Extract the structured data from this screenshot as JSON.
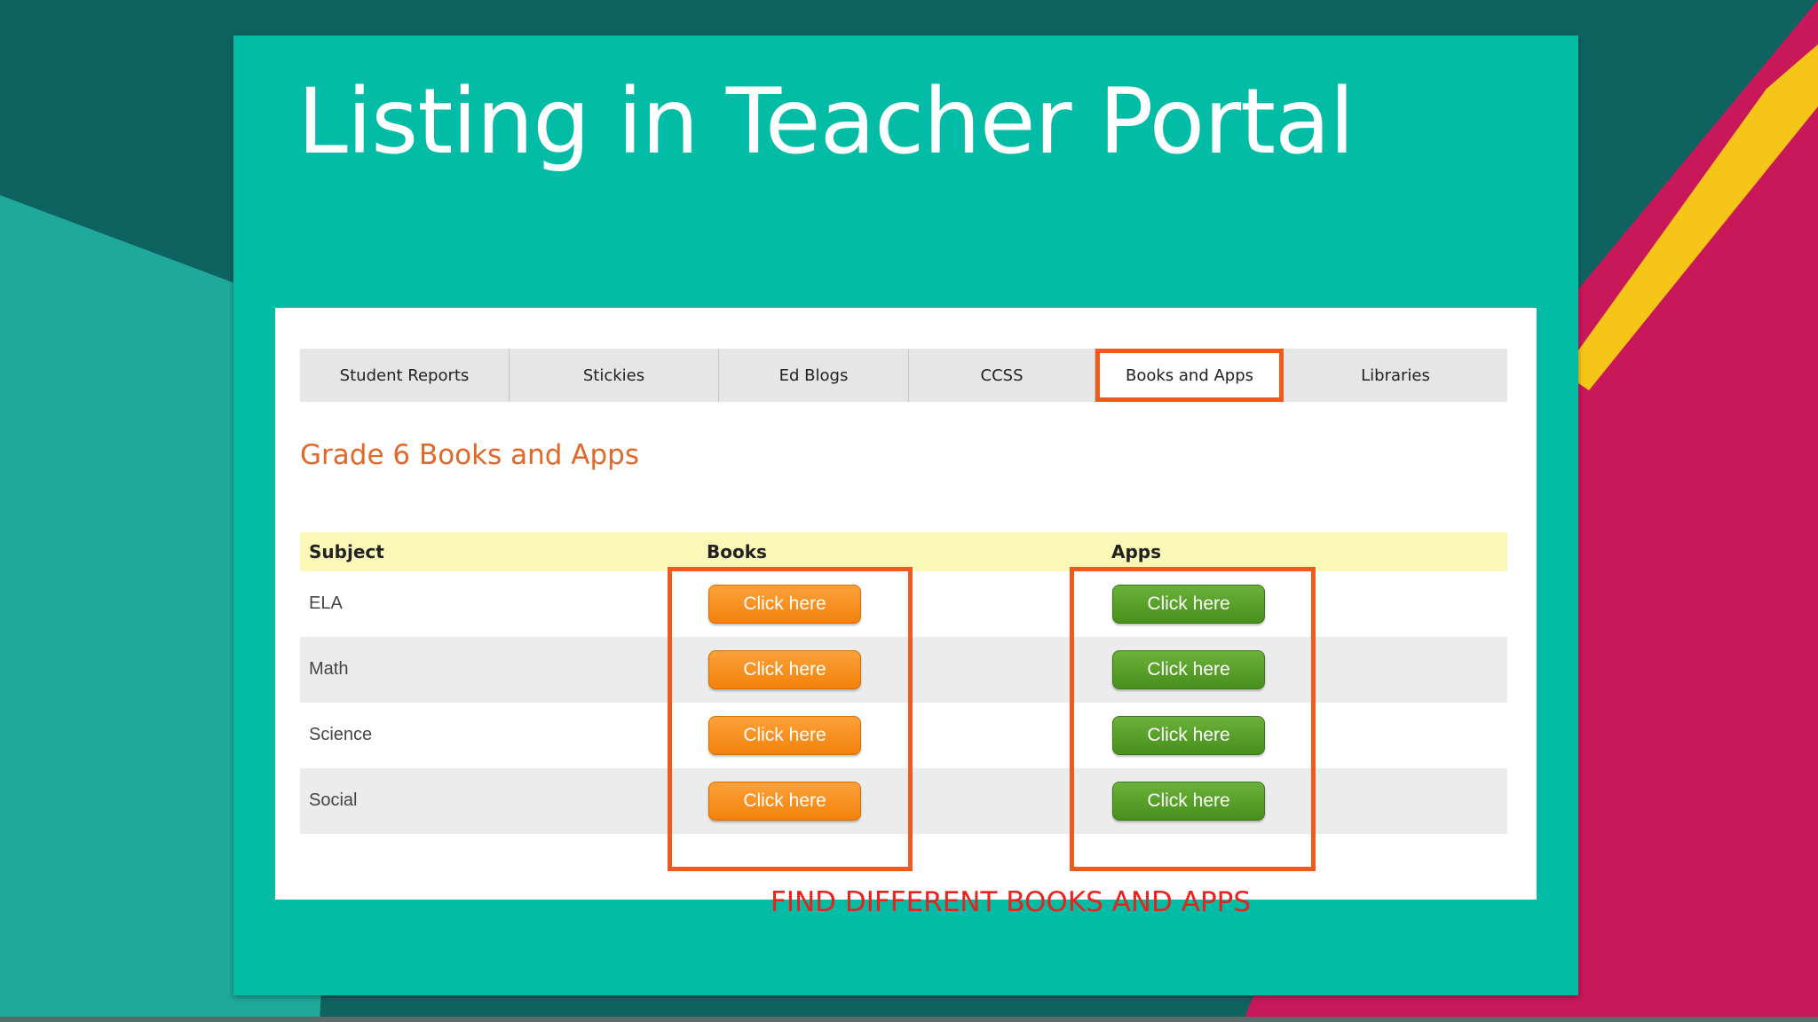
{
  "slide": {
    "title": "Listing in Teacher Portal",
    "background_color": "#03bca6"
  },
  "portal": {
    "tabs": [
      {
        "label": "Student Reports",
        "active": false
      },
      {
        "label": "Stickies",
        "active": false
      },
      {
        "label": "Ed Blogs",
        "active": false
      },
      {
        "label": "CCSS",
        "active": false
      },
      {
        "label": "Books and Apps",
        "active": true
      },
      {
        "label": "Libraries",
        "active": false
      }
    ],
    "heading": "Grade 6 Books and Apps",
    "table": {
      "headers": {
        "subject": "Subject",
        "books": "Books",
        "apps": "Apps"
      },
      "rows": [
        {
          "subject": "ELA",
          "books_button": "Click here",
          "apps_button": "Click here"
        },
        {
          "subject": "Math",
          "books_button": "Click here",
          "apps_button": "Click here"
        },
        {
          "subject": "Science",
          "books_button": "Click here",
          "apps_button": "Click here"
        },
        {
          "subject": "Social",
          "books_button": "Click here",
          "apps_button": "Click here"
        }
      ]
    },
    "caption": "FIND DIFFERENT BOOKS AND APPS"
  },
  "colors": {
    "highlight": "#f05a1e",
    "books_button": "#f3820c",
    "apps_button": "#47901c",
    "heading": "#e0692a",
    "caption": "#e8221c"
  }
}
